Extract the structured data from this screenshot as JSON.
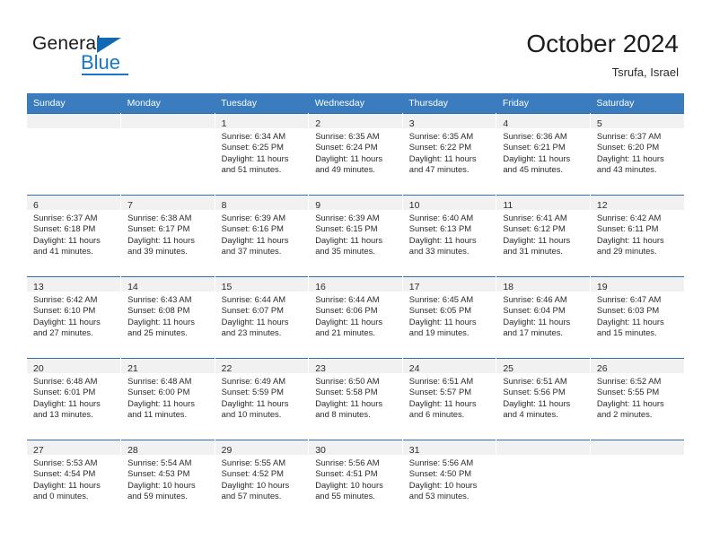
{
  "brand": {
    "name_top": "General",
    "name_bottom": "Blue",
    "accent_color": "#1577c6",
    "triangle_color": "#1268b3"
  },
  "header": {
    "title": "October 2024",
    "location": "Tsrufa, Israel"
  },
  "theme": {
    "header_row_bg": "#3a7cbe",
    "row_border": "#2f6fae",
    "daynum_band_bg": "#f1f1f1",
    "text": "#2b2b2b"
  },
  "weekday_headers": [
    "Sunday",
    "Monday",
    "Tuesday",
    "Wednesday",
    "Thursday",
    "Friday",
    "Saturday"
  ],
  "weeks": [
    [
      {
        "day": "",
        "sunrise": "",
        "sunset": "",
        "daylight_1": "",
        "daylight_2": ""
      },
      {
        "day": "",
        "sunrise": "",
        "sunset": "",
        "daylight_1": "",
        "daylight_2": ""
      },
      {
        "day": "1",
        "sunrise": "Sunrise: 6:34 AM",
        "sunset": "Sunset: 6:25 PM",
        "daylight_1": "Daylight: 11 hours",
        "daylight_2": "and 51 minutes."
      },
      {
        "day": "2",
        "sunrise": "Sunrise: 6:35 AM",
        "sunset": "Sunset: 6:24 PM",
        "daylight_1": "Daylight: 11 hours",
        "daylight_2": "and 49 minutes."
      },
      {
        "day": "3",
        "sunrise": "Sunrise: 6:35 AM",
        "sunset": "Sunset: 6:22 PM",
        "daylight_1": "Daylight: 11 hours",
        "daylight_2": "and 47 minutes."
      },
      {
        "day": "4",
        "sunrise": "Sunrise: 6:36 AM",
        "sunset": "Sunset: 6:21 PM",
        "daylight_1": "Daylight: 11 hours",
        "daylight_2": "and 45 minutes."
      },
      {
        "day": "5",
        "sunrise": "Sunrise: 6:37 AM",
        "sunset": "Sunset: 6:20 PM",
        "daylight_1": "Daylight: 11 hours",
        "daylight_2": "and 43 minutes."
      }
    ],
    [
      {
        "day": "6",
        "sunrise": "Sunrise: 6:37 AM",
        "sunset": "Sunset: 6:18 PM",
        "daylight_1": "Daylight: 11 hours",
        "daylight_2": "and 41 minutes."
      },
      {
        "day": "7",
        "sunrise": "Sunrise: 6:38 AM",
        "sunset": "Sunset: 6:17 PM",
        "daylight_1": "Daylight: 11 hours",
        "daylight_2": "and 39 minutes."
      },
      {
        "day": "8",
        "sunrise": "Sunrise: 6:39 AM",
        "sunset": "Sunset: 6:16 PM",
        "daylight_1": "Daylight: 11 hours",
        "daylight_2": "and 37 minutes."
      },
      {
        "day": "9",
        "sunrise": "Sunrise: 6:39 AM",
        "sunset": "Sunset: 6:15 PM",
        "daylight_1": "Daylight: 11 hours",
        "daylight_2": "and 35 minutes."
      },
      {
        "day": "10",
        "sunrise": "Sunrise: 6:40 AM",
        "sunset": "Sunset: 6:13 PM",
        "daylight_1": "Daylight: 11 hours",
        "daylight_2": "and 33 minutes."
      },
      {
        "day": "11",
        "sunrise": "Sunrise: 6:41 AM",
        "sunset": "Sunset: 6:12 PM",
        "daylight_1": "Daylight: 11 hours",
        "daylight_2": "and 31 minutes."
      },
      {
        "day": "12",
        "sunrise": "Sunrise: 6:42 AM",
        "sunset": "Sunset: 6:11 PM",
        "daylight_1": "Daylight: 11 hours",
        "daylight_2": "and 29 minutes."
      }
    ],
    [
      {
        "day": "13",
        "sunrise": "Sunrise: 6:42 AM",
        "sunset": "Sunset: 6:10 PM",
        "daylight_1": "Daylight: 11 hours",
        "daylight_2": "and 27 minutes."
      },
      {
        "day": "14",
        "sunrise": "Sunrise: 6:43 AM",
        "sunset": "Sunset: 6:08 PM",
        "daylight_1": "Daylight: 11 hours",
        "daylight_2": "and 25 minutes."
      },
      {
        "day": "15",
        "sunrise": "Sunrise: 6:44 AM",
        "sunset": "Sunset: 6:07 PM",
        "daylight_1": "Daylight: 11 hours",
        "daylight_2": "and 23 minutes."
      },
      {
        "day": "16",
        "sunrise": "Sunrise: 6:44 AM",
        "sunset": "Sunset: 6:06 PM",
        "daylight_1": "Daylight: 11 hours",
        "daylight_2": "and 21 minutes."
      },
      {
        "day": "17",
        "sunrise": "Sunrise: 6:45 AM",
        "sunset": "Sunset: 6:05 PM",
        "daylight_1": "Daylight: 11 hours",
        "daylight_2": "and 19 minutes."
      },
      {
        "day": "18",
        "sunrise": "Sunrise: 6:46 AM",
        "sunset": "Sunset: 6:04 PM",
        "daylight_1": "Daylight: 11 hours",
        "daylight_2": "and 17 minutes."
      },
      {
        "day": "19",
        "sunrise": "Sunrise: 6:47 AM",
        "sunset": "Sunset: 6:03 PM",
        "daylight_1": "Daylight: 11 hours",
        "daylight_2": "and 15 minutes."
      }
    ],
    [
      {
        "day": "20",
        "sunrise": "Sunrise: 6:48 AM",
        "sunset": "Sunset: 6:01 PM",
        "daylight_1": "Daylight: 11 hours",
        "daylight_2": "and 13 minutes."
      },
      {
        "day": "21",
        "sunrise": "Sunrise: 6:48 AM",
        "sunset": "Sunset: 6:00 PM",
        "daylight_1": "Daylight: 11 hours",
        "daylight_2": "and 11 minutes."
      },
      {
        "day": "22",
        "sunrise": "Sunrise: 6:49 AM",
        "sunset": "Sunset: 5:59 PM",
        "daylight_1": "Daylight: 11 hours",
        "daylight_2": "and 10 minutes."
      },
      {
        "day": "23",
        "sunrise": "Sunrise: 6:50 AM",
        "sunset": "Sunset: 5:58 PM",
        "daylight_1": "Daylight: 11 hours",
        "daylight_2": "and 8 minutes."
      },
      {
        "day": "24",
        "sunrise": "Sunrise: 6:51 AM",
        "sunset": "Sunset: 5:57 PM",
        "daylight_1": "Daylight: 11 hours",
        "daylight_2": "and 6 minutes."
      },
      {
        "day": "25",
        "sunrise": "Sunrise: 6:51 AM",
        "sunset": "Sunset: 5:56 PM",
        "daylight_1": "Daylight: 11 hours",
        "daylight_2": "and 4 minutes."
      },
      {
        "day": "26",
        "sunrise": "Sunrise: 6:52 AM",
        "sunset": "Sunset: 5:55 PM",
        "daylight_1": "Daylight: 11 hours",
        "daylight_2": "and 2 minutes."
      }
    ],
    [
      {
        "day": "27",
        "sunrise": "Sunrise: 5:53 AM",
        "sunset": "Sunset: 4:54 PM",
        "daylight_1": "Daylight: 11 hours",
        "daylight_2": "and 0 minutes."
      },
      {
        "day": "28",
        "sunrise": "Sunrise: 5:54 AM",
        "sunset": "Sunset: 4:53 PM",
        "daylight_1": "Daylight: 10 hours",
        "daylight_2": "and 59 minutes."
      },
      {
        "day": "29",
        "sunrise": "Sunrise: 5:55 AM",
        "sunset": "Sunset: 4:52 PM",
        "daylight_1": "Daylight: 10 hours",
        "daylight_2": "and 57 minutes."
      },
      {
        "day": "30",
        "sunrise": "Sunrise: 5:56 AM",
        "sunset": "Sunset: 4:51 PM",
        "daylight_1": "Daylight: 10 hours",
        "daylight_2": "and 55 minutes."
      },
      {
        "day": "31",
        "sunrise": "Sunrise: 5:56 AM",
        "sunset": "Sunset: 4:50 PM",
        "daylight_1": "Daylight: 10 hours",
        "daylight_2": "and 53 minutes."
      },
      {
        "day": "",
        "sunrise": "",
        "sunset": "",
        "daylight_1": "",
        "daylight_2": ""
      },
      {
        "day": "",
        "sunrise": "",
        "sunset": "",
        "daylight_1": "",
        "daylight_2": ""
      }
    ]
  ]
}
